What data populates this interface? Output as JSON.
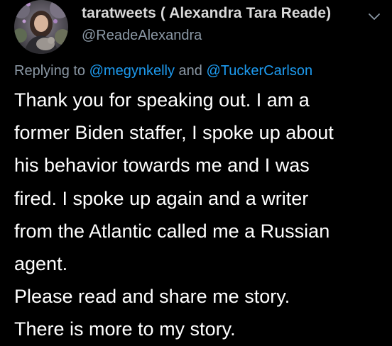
{
  "tweet": {
    "author": {
      "display_name": "taratweets ( Alexandra Tara Reade)",
      "handle": "@ReadeAlexandra"
    },
    "reply": {
      "prefix": "Replying to",
      "mention_1": "@megynkelly",
      "connector": "and",
      "mention_2": "@TuckerCarlson"
    },
    "body_lines": [
      "Thank you for speaking out. I am a",
      "former Biden staffer, I spoke up about",
      "his behavior towards me and I was",
      "fired. I spoke up again and a writer",
      "from the Atlantic called me a Russian",
      "agent.",
      "Please read and share me story.",
      "There is more to my story."
    ],
    "icons": {
      "avatar": "profile-photo",
      "menu": "chevron-down-icon"
    },
    "colors": {
      "background": "#000000",
      "text": "#ffffff",
      "secondary": "#8b98a5",
      "link": "#1d9bf0"
    }
  }
}
